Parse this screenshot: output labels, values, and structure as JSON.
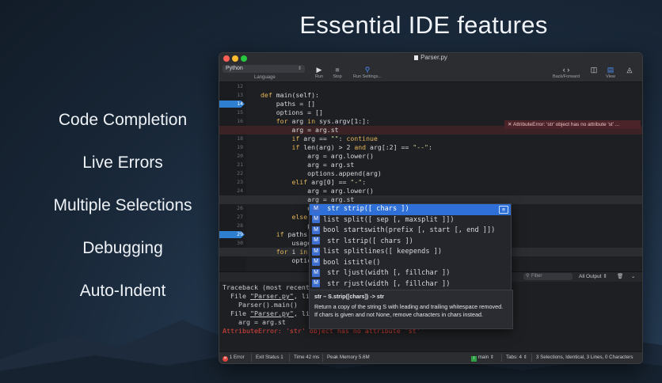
{
  "headline": "Essential IDE features",
  "features": [
    "Code Completion",
    "Live Errors",
    "Multiple Selections",
    "Debugging",
    "Auto-Indent"
  ],
  "window": {
    "title": "Parser.py",
    "language_value": "Python",
    "language_label": "Language",
    "run_label": "Run",
    "stop_label": "Stop",
    "run_settings_label": "Run Settings...",
    "back_forward_label": "Back/Forward",
    "view_label": "View"
  },
  "editor": {
    "line_numbers": [
      "12",
      "13",
      "14",
      "15",
      "16",
      "17",
      "18",
      "19",
      "20",
      "21",
      "22",
      "23",
      "24",
      "25",
      "26",
      "27",
      "28",
      "29",
      "30",
      "31"
    ],
    "breakpoints": [
      "14",
      "29"
    ],
    "error_message": "AttributeError: 'str' object has no attribute 'st' ..."
  },
  "autocomplete": {
    "items": [
      {
        "type": "str",
        "name": "strip([ chars ])",
        "badge": "M"
      },
      {
        "type": "list",
        "name": "split([ sep [, maxsplit ]])",
        "badge": "M"
      },
      {
        "type": "bool",
        "name": "startswith(prefix [, start [, end ]])",
        "badge": "M"
      },
      {
        "type": "str",
        "name": "lstrip([ chars ])",
        "badge": "M"
      },
      {
        "type": "list",
        "name": "splitlines([ keepends ])",
        "badge": "M"
      },
      {
        "type": "bool",
        "name": "istitle()",
        "badge": "M"
      },
      {
        "type": "str",
        "name": "ljust(width [, fillchar ])",
        "badge": "M"
      },
      {
        "type": "str",
        "name": "rjust(width [, fillchar ])",
        "badge": "M"
      }
    ],
    "doc_signature": "str – S.strip([chars]) -> str",
    "doc_text": "Return a copy of the string S with leading and trailing whitespace removed. If chars is given and not None, remove characters in chars instead."
  },
  "output": {
    "filter_placeholder": "Filter",
    "selector": "All Output",
    "lines": {
      "traceback": "Traceback (most recent",
      "file1_prefix": "  File ",
      "file1_name": "\"Parser.py\"",
      "file1_rest": ", li",
      "call": "    Parser().main()",
      "file2_prefix": "  File ",
      "file2_name": "\"Parser.py\"",
      "file2_rest": ", li",
      "stmt": "    arg = arg.st",
      "error": "AttributeError: 'str' object has no attribute 'st'"
    }
  },
  "status": {
    "errors": "1 Error",
    "exit": "Exit Status 1",
    "time": "Time 42 ms",
    "memory": "Peak Memory 5.6M",
    "branch": "main",
    "tabs": "Tabs: 4",
    "selections": "3 Selections, Identical, 3 Lines, 0 Characters"
  },
  "colors": {
    "accent": "#2f6fd8",
    "error": "#e2443c",
    "keyword": "#e4b65a",
    "string": "#c2d39a"
  }
}
